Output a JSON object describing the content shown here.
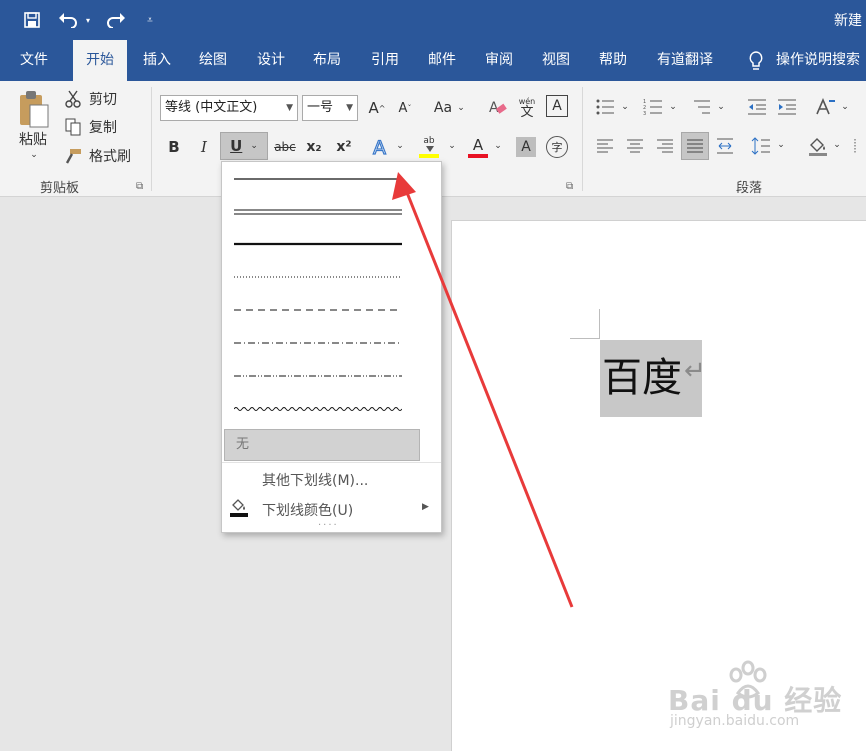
{
  "title_bar": {
    "title": "新建"
  },
  "tabs": [
    "文件",
    "开始",
    "插入",
    "绘图",
    "设计",
    "布局",
    "引用",
    "邮件",
    "审阅",
    "视图",
    "帮助",
    "有道翻译"
  ],
  "tell_me": "操作说明搜索",
  "clipboard": {
    "paste": "粘贴",
    "cut": "剪切",
    "copy": "复制",
    "format_painter": "格式刷",
    "group_label": "剪贴板"
  },
  "font": {
    "font_name": "等线 (中文正文)",
    "font_size": "一号",
    "bold": "B",
    "italic": "I",
    "underline": "U",
    "strike": "abc",
    "subscript": "x₂",
    "superscript": "x²",
    "change_case": "Aa",
    "phonetic_top": "wén",
    "phonetic_bottom": "文"
  },
  "paragraph": {
    "group_label": "段落"
  },
  "underline_menu": {
    "none_label": "无",
    "more_underlines": "其他下划线(M)...",
    "underline_color": "下划线颜色(U)"
  },
  "document": {
    "text": "百度"
  },
  "watermark": {
    "brand": "Bai du 经验",
    "url": "jingyan.baidu.com"
  },
  "colors": {
    "title_blue": "#2b579a",
    "ribbon_bg": "#f3f3f3",
    "arrow_red": "#e83a3a",
    "font_color_red": "#e81123",
    "highlight_yellow": "#ffff00"
  }
}
